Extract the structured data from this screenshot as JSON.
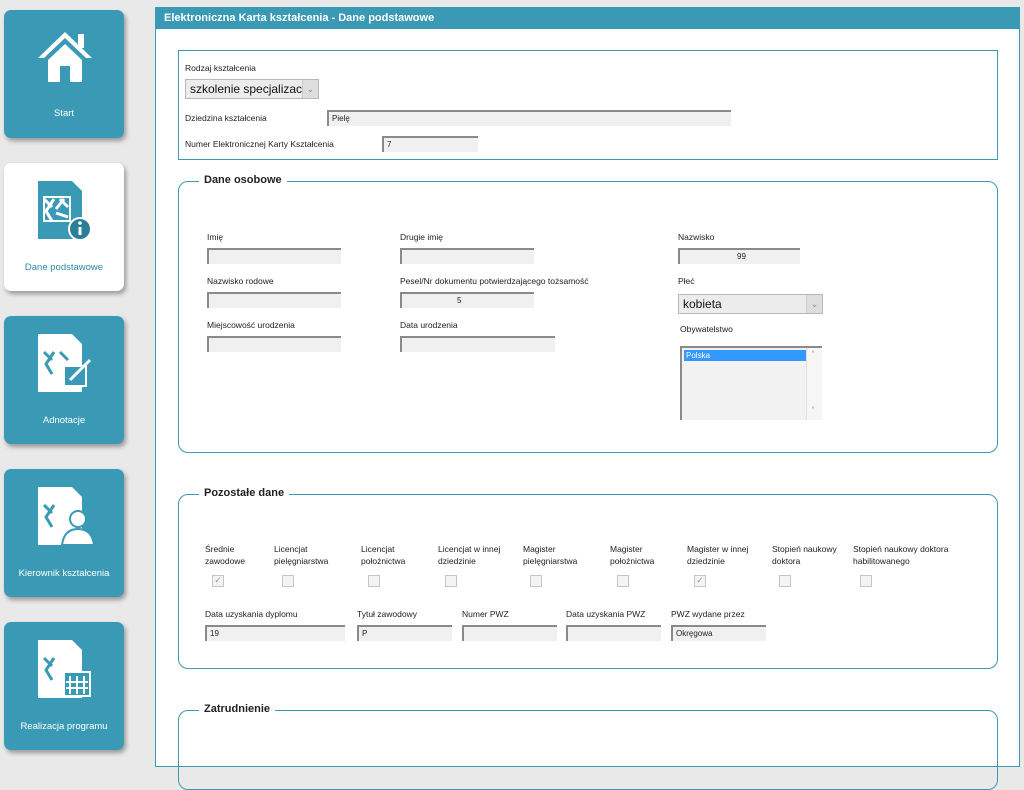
{
  "nav": {
    "items": [
      {
        "label": "Start",
        "icon": "home-icon"
      },
      {
        "label": "Dane podstawowe",
        "icon": "document-info-icon"
      },
      {
        "label": "Adnotacje",
        "icon": "document-edit-icon"
      },
      {
        "label": "Kierownik kształcenia",
        "icon": "document-person-icon"
      },
      {
        "label": "Realizacja programu",
        "icon": "document-calendar-icon"
      }
    ],
    "active": "Dane podstawowe"
  },
  "panel_title": "Elektroniczna Karta kształcenia - Dane podstawowe",
  "basic": {
    "rodzaj_label": "Rodzaj kształcenia",
    "rodzaj_value": "szkolenie specjalizac",
    "dziedzina_label": "Dziedzina kształcenia",
    "dziedzina_value": "Pielę",
    "numer_label": "Numer Elektronicznej Karty Kształcenia",
    "numer_value": "7"
  },
  "personal": {
    "legend": "Dane osobowe",
    "imie_label": "Imię",
    "imie_value": "",
    "drugie_imie_label": "Drugie imię",
    "drugie_imie_value": "",
    "nazwisko_label": "Nazwisko",
    "nazwisko_value": "99",
    "nazwisko_rodowe_label": "Nazwisko rodowe",
    "nazwisko_rodowe_value": "",
    "pesel_label": "Pesel/Nr dokumentu potwierdzającego tożsamość",
    "pesel_value": "5",
    "plec_label": "Płeć",
    "plec_value": "kobieta",
    "miejscowosc_label": "Miejscowość urodzenia",
    "miejscowosc_value": "",
    "data_urodzenia_label": "Data urodzenia",
    "data_urodzenia_value": "",
    "obywatelstwo_label": "Obywatelstwo",
    "obywatelstwo_selected": "Polska"
  },
  "other": {
    "legend": "Pozostałe dane",
    "checks": [
      {
        "label": "Średnie zawodowe",
        "checked": true
      },
      {
        "label": "Licencjat pielęgniarstwa",
        "checked": false
      },
      {
        "label": "Licencjat położnictwa",
        "checked": false
      },
      {
        "label": "Licencjat w innej dziedzinie",
        "checked": false
      },
      {
        "label": "Magister pielęgniarstwa",
        "checked": false
      },
      {
        "label": "Magister położnictwa",
        "checked": false
      },
      {
        "label": "Magister w innej dziedzinie",
        "checked": true
      },
      {
        "label": "Stopień naukowy doktora",
        "checked": false
      },
      {
        "label": "Stopień naukowy doktora habilitowanego",
        "checked": false
      }
    ],
    "data_dyplomu_label": "Data uzyskania dyplomu",
    "data_dyplomu_value": "19",
    "tytul_label": "Tytuł zawodowy",
    "tytul_value": "P",
    "numer_pwz_label": "Numer PWZ",
    "numer_pwz_value": "",
    "data_pwz_label": "Data uzyskania PWZ",
    "data_pwz_value": "",
    "pwz_wydane_label": "PWZ wydane przez",
    "pwz_wydane_value": "Okręgowa"
  },
  "employment": {
    "legend": "Zatrudnienie"
  }
}
